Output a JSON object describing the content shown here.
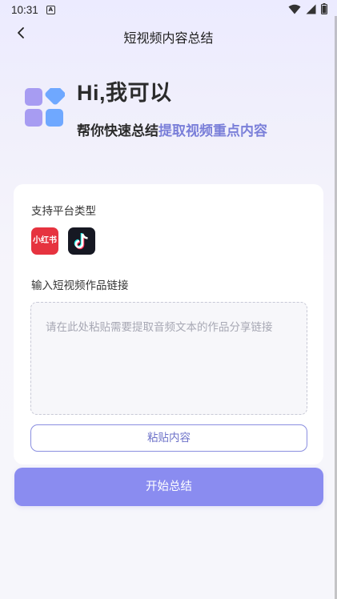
{
  "status_bar": {
    "time": "10:31",
    "notification_glyph": "A"
  },
  "header": {
    "title": "短视频内容总结",
    "back_icon": "chevron-left-icon"
  },
  "hero": {
    "title": "Hi,我可以",
    "subtitle_prefix": "帮你快速总结",
    "subtitle_accent": "提取视频重点内容",
    "logo_icon": "app-grid-icon"
  },
  "card": {
    "platforms_label": "支持平台类型",
    "platforms": [
      {
        "name": "小红书",
        "icon": "xiaohongshu-icon"
      },
      {
        "name": "抖音",
        "icon": "douyin-icon"
      }
    ],
    "link_label": "输入短视频作品链接",
    "link_placeholder": "请在此处粘贴需要提取音频文本的作品分享链接",
    "link_value": "",
    "paste_label": "粘贴内容"
  },
  "actions": {
    "start_label": "开始总结"
  },
  "colors": {
    "accent": "#7a7fd9",
    "primary_button": "#8a8cf0",
    "xhs_red": "#e6333f",
    "douyin_black": "#161823"
  }
}
